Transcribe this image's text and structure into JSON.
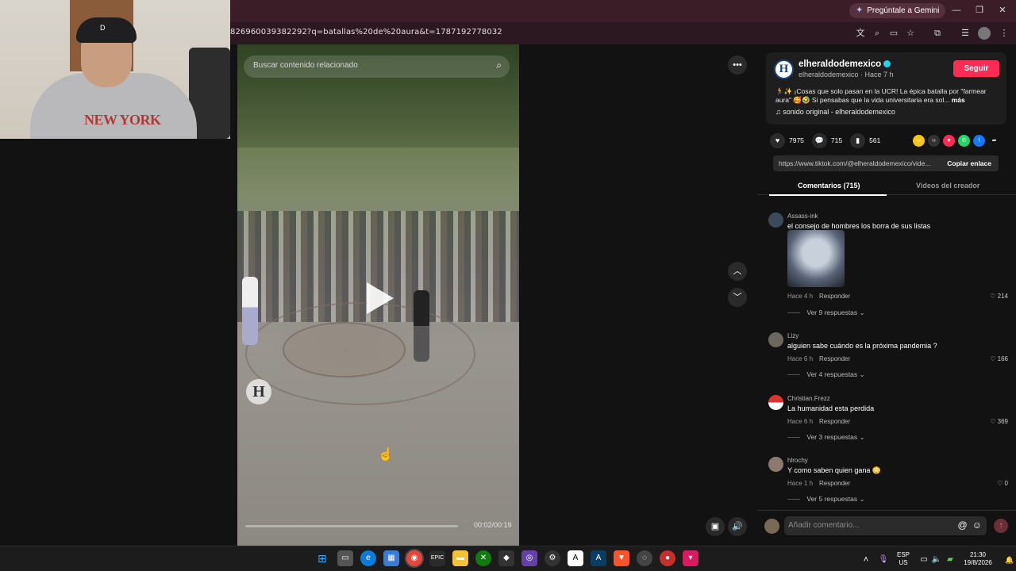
{
  "browser": {
    "gemini_label": "Pregúntale a Gemini",
    "url": "826960039382292?q=batallas%20de%20aura&t=1787192778032"
  },
  "video": {
    "search_placeholder": "Buscar contenido relacionado",
    "time": "00:02/00:19",
    "logo_letter": "H",
    "progress_fraction": 0.0
  },
  "webcam": {
    "shirt_text": "NEW YORK",
    "cap_mark": "D"
  },
  "creator": {
    "avatar_letter": "H",
    "username": "elheraldodemexico",
    "subline": "elheraldodemexico · Hace 7 h",
    "follow_label": "Seguir",
    "description": "🏃✨ ¡Cosas que solo pasan en la UCR! La épica batalla por \"farmear aura\" 🥰🤣 Si pensabas que la vida universitaria era sol...",
    "more_label": "más",
    "sound": "sonido original - elheraldodemexico"
  },
  "stats": {
    "likes": "7975",
    "comments": "715",
    "saves": "561"
  },
  "link": {
    "url": "https://www.tiktok.com/@elheraldodemexico/vide...",
    "copy_label": "Copiar enlace"
  },
  "tabs": {
    "comments": "Comentarios (715)",
    "creator_videos": "Videos del creador"
  },
  "comments": [
    {
      "user": "Assass-ink",
      "text": "el consejo de hombres los borra de sus listas",
      "time": "Hace 4 h",
      "reply": "Responder",
      "likes": "214",
      "replies": "Ver 9 respuestas"
    },
    {
      "user": "Lizy",
      "text": "alguien sabe cuándo es la próxima pandemia ?",
      "time": "Hace 6 h",
      "reply": "Responder",
      "likes": "166",
      "replies": "Ver 4 respuestas"
    },
    {
      "user": "Christian.Frezz",
      "text": "La humanidad esta perdida",
      "time": "Hace 6 h",
      "reply": "Responder",
      "likes": "369",
      "replies": "Ver 3 respuestas"
    },
    {
      "user": "hlrochy",
      "text": "Y como saben quien gana 😳",
      "time": "Hace 1 h",
      "reply": "Responder",
      "likes": "0",
      "replies": "Ver 5 respuestas"
    }
  ],
  "comment_bar": {
    "placeholder": "Añadir comentario..."
  },
  "taskbar": {
    "lang_top": "ESP",
    "lang_bottom": "US",
    "time": "21:30",
    "date": "19/8/2026"
  }
}
